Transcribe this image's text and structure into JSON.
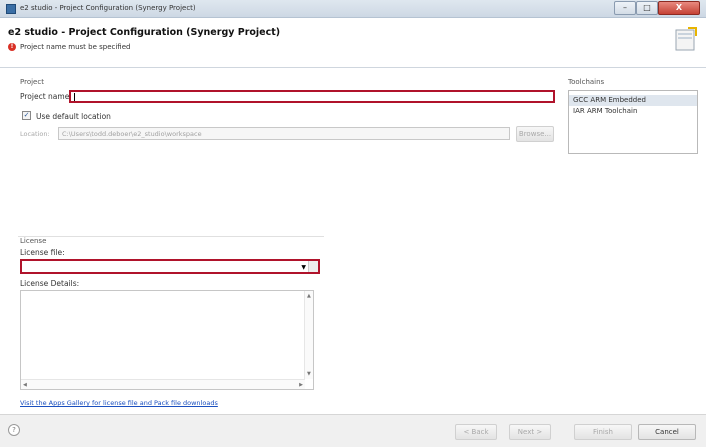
{
  "window": {
    "title": "e2 studio - Project Configuration (Synergy Project)",
    "minimize_glyph": "–",
    "maximize_glyph": "□",
    "close_glyph": "X"
  },
  "header": {
    "title": "e2 studio - Project Configuration  (Synergy Project)",
    "error_message": "Project name must be specified",
    "error_icon": "error-icon"
  },
  "project": {
    "section_label": "Project",
    "name_label": "Project name",
    "name_value": "",
    "use_default_location_label": "Use default location",
    "use_default_location_checked": true,
    "location_label": "Location:",
    "location_value": "C:\\Users\\todd.deboer\\e2_studio\\workspace",
    "browse_label": "Browse..."
  },
  "toolchains": {
    "section_label": "Toolchains",
    "items": [
      {
        "label": "GCC ARM Embedded",
        "selected": true
      },
      {
        "label": "IAR ARM Toolchain",
        "selected": false
      }
    ]
  },
  "license": {
    "section_label": "License",
    "file_label": "License file:",
    "file_value": "",
    "details_label": "License Details:",
    "gallery_link": "Visit the Apps Gallery for license file and Pack file downloads"
  },
  "footer": {
    "help_glyph": "?",
    "back_label": "< Back",
    "next_label": "Next >",
    "finish_label": "Finish",
    "cancel_label": "Cancel"
  },
  "colors": {
    "error_border": "#b0132b",
    "link": "#1a4fbf",
    "selection": "#dfe6ee"
  }
}
